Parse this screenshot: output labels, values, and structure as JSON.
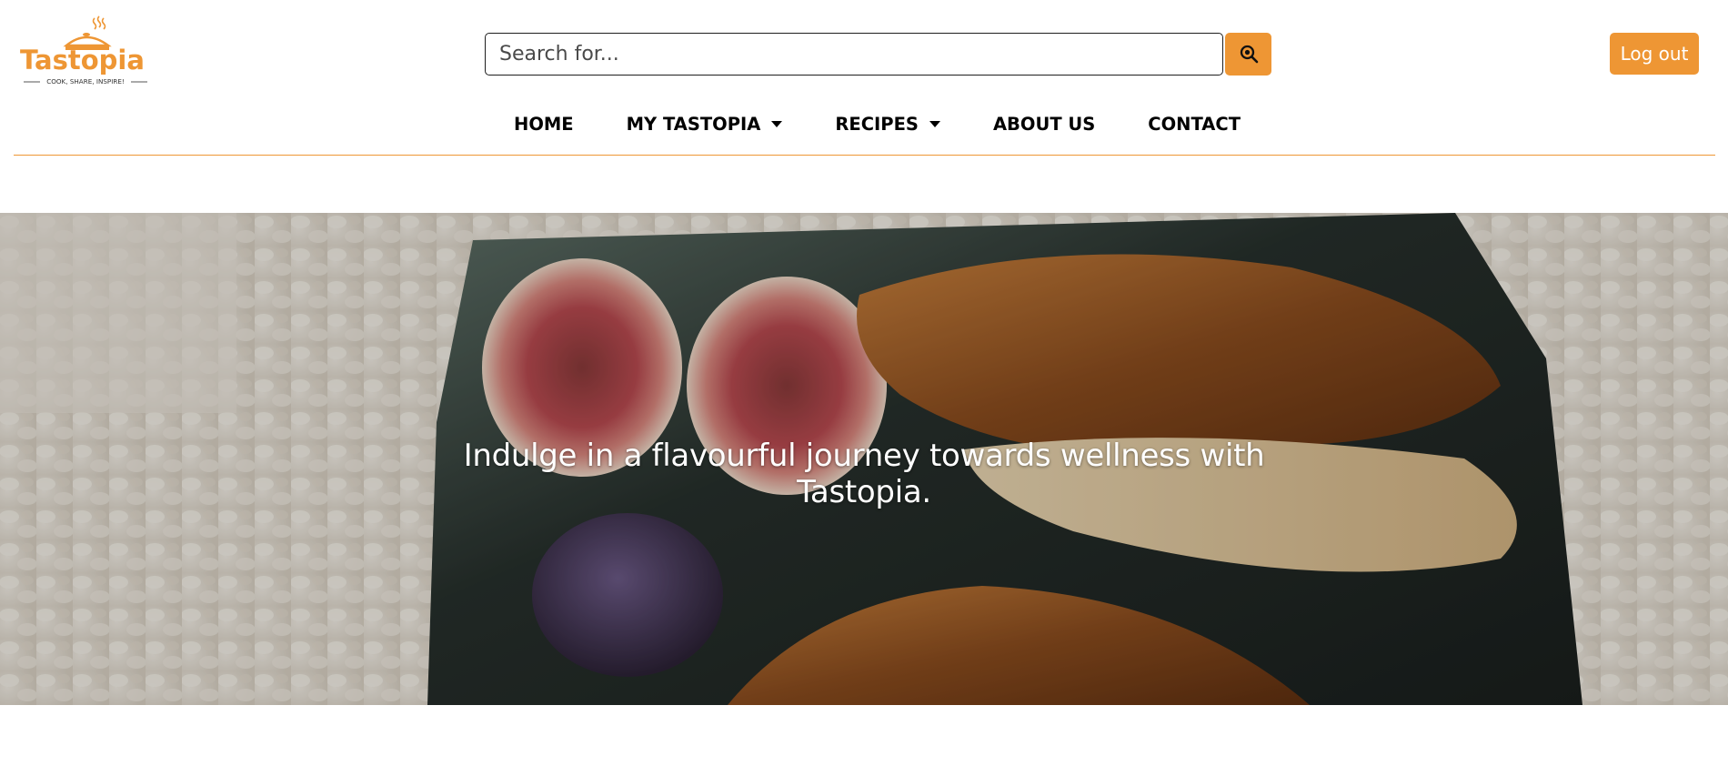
{
  "brand": {
    "name": "Tastopia",
    "tagline": "COOK, SHARE, INSPIRE!",
    "accent_color": "#ee9634"
  },
  "search": {
    "placeholder": "Search for...",
    "button_icon": "search-icon"
  },
  "account": {
    "logout_label": "Log out"
  },
  "nav": {
    "items": [
      {
        "label": "HOME",
        "dropdown": false
      },
      {
        "label": "MY TASTOPIA",
        "dropdown": true
      },
      {
        "label": "RECIPES",
        "dropdown": true
      },
      {
        "label": "ABOUT US",
        "dropdown": false
      },
      {
        "label": "CONTACT",
        "dropdown": false
      }
    ]
  },
  "hero": {
    "headline": "Indulge in a flavourful journey towards wellness with Tastopia."
  }
}
